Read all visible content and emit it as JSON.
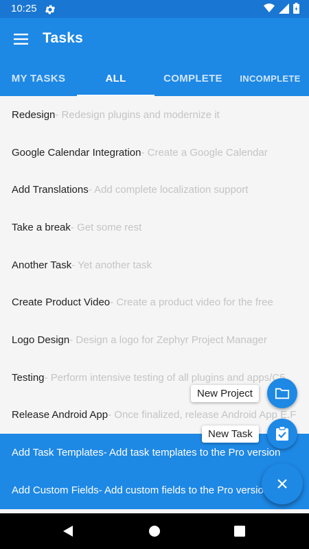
{
  "status": {
    "time": "10:25"
  },
  "appbar": {
    "title": "Tasks"
  },
  "tabs": [
    {
      "label": "MY TASKS"
    },
    {
      "label": "ALL"
    },
    {
      "label": "COMPLETE"
    },
    {
      "label": "INCOMPLETE"
    }
  ],
  "tasks": [
    {
      "title": "Redesign",
      "desc": " - Redesign plugins and modernize it"
    },
    {
      "title": "Google Calendar Integration",
      "desc": " - Create a Google Calendar"
    },
    {
      "title": "Add Translations",
      "desc": " - Add complete localization support"
    },
    {
      "title": "Take a break",
      "desc": " - Get some rest"
    },
    {
      "title": "Another Task",
      "desc": " - Yet another task"
    },
    {
      "title": "Create Product Video",
      "desc": " - Create a product video for the free"
    },
    {
      "title": "Logo Design",
      "desc": " - Design a logo for Zephyr Project Manager"
    },
    {
      "title": "Testing",
      "desc": " - Perform intensive testing of all plugins and apps/C5"
    },
    {
      "title": "Release Android App",
      "desc": " - Once finalized, release Android App E.F"
    },
    {
      "title": "Add Task Templates",
      "desc": " - Add task templates to the Pro version"
    },
    {
      "title": "Add Custom Fields",
      "desc": " - Add custom fields to the Pro version"
    }
  ],
  "fab": {
    "new_project": "New Project",
    "new_task": "New Task"
  },
  "colors": {
    "primary": "#1e88e5",
    "status_bar": "#1976d2"
  }
}
